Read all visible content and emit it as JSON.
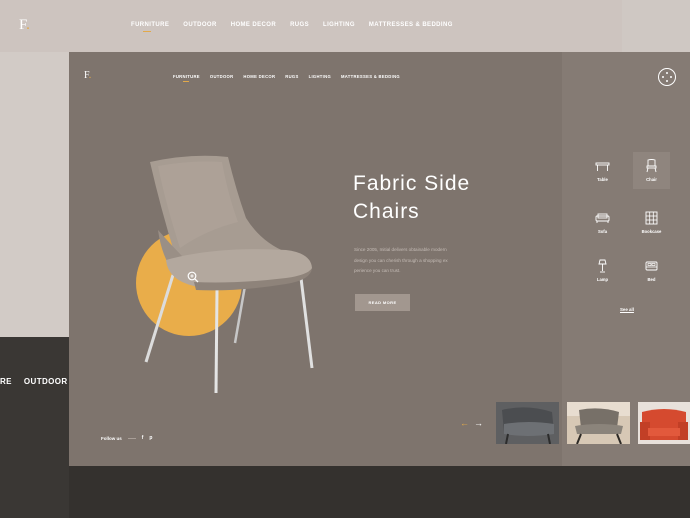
{
  "background": {
    "logo": "F",
    "logo_dot": ".",
    "nav": [
      "FURNITURE",
      "OUTDOOR",
      "HOME DECOR",
      "RUGS",
      "LIGHTING",
      "MATTRESSES & BEDDING"
    ],
    "dark_nav": [
      "RE",
      "OUTDOOR"
    ]
  },
  "header": {
    "logo": "F",
    "logo_dot": ".",
    "nav": [
      "FURNITURE",
      "OUTDOOR",
      "HOME DECOR",
      "RUGS",
      "LIGHTING",
      "MATTRESSES & BEDDING"
    ],
    "active_nav": "FURNITURE",
    "menu_icon": "compass-menu-icon"
  },
  "hero": {
    "title_line1": "Fabric Side",
    "title_line2": "Chairs",
    "description_line1": "Since 2005, Initial delivers obtainable modern",
    "description_line2": "design you can cherish through a shopping ex",
    "description_line3": "perience you can trust.",
    "cta_label": "READ MORE",
    "accent_color": "#e9ad4a"
  },
  "footer": {
    "follow_label": "Follow us",
    "social": [
      "f",
      "p"
    ]
  },
  "carousel": {
    "prev_icon": "arrow-left-icon",
    "next_icon": "arrow-right-icon",
    "prev_glyph": "←",
    "next_glyph": "→"
  },
  "categories": [
    {
      "label": "Table",
      "icon": "table-icon",
      "active": false
    },
    {
      "label": "Chair",
      "icon": "chair-icon",
      "active": true
    },
    {
      "label": "Sofa",
      "icon": "sofa-icon",
      "active": false
    },
    {
      "label": "Bookcase",
      "icon": "bookcase-icon",
      "active": false
    },
    {
      "label": "Lamp",
      "icon": "lamp-icon",
      "active": false
    },
    {
      "label": "Bed",
      "icon": "bed-icon",
      "active": false
    }
  ],
  "see_all_label": "See all",
  "colors": {
    "card": "#7e746d",
    "sidebar": "#857b74",
    "accent": "#e2a94a",
    "dark": "#3a3734"
  }
}
